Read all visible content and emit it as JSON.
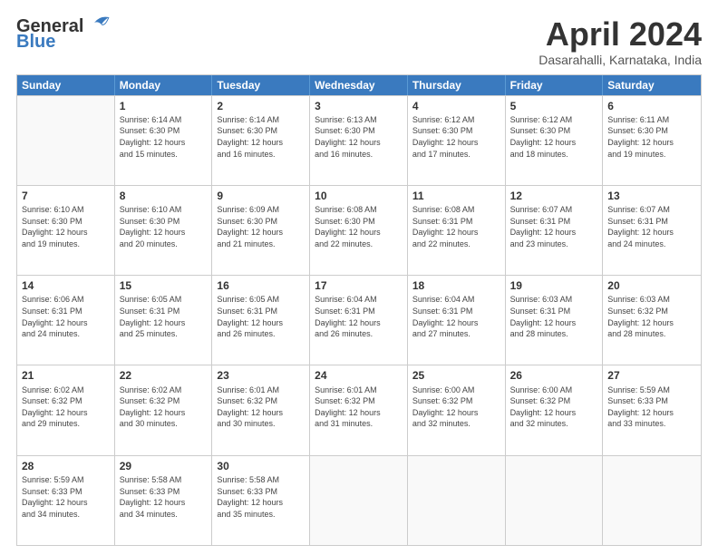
{
  "header": {
    "logo_line1": "General",
    "logo_line2": "Blue",
    "month_title": "April 2024",
    "location": "Dasarahalli, Karnataka, India"
  },
  "days_of_week": [
    "Sunday",
    "Monday",
    "Tuesday",
    "Wednesday",
    "Thursday",
    "Friday",
    "Saturday"
  ],
  "weeks": [
    [
      {
        "day": "",
        "info": ""
      },
      {
        "day": "1",
        "info": "Sunrise: 6:14 AM\nSunset: 6:30 PM\nDaylight: 12 hours\nand 15 minutes."
      },
      {
        "day": "2",
        "info": "Sunrise: 6:14 AM\nSunset: 6:30 PM\nDaylight: 12 hours\nand 16 minutes."
      },
      {
        "day": "3",
        "info": "Sunrise: 6:13 AM\nSunset: 6:30 PM\nDaylight: 12 hours\nand 16 minutes."
      },
      {
        "day": "4",
        "info": "Sunrise: 6:12 AM\nSunset: 6:30 PM\nDaylight: 12 hours\nand 17 minutes."
      },
      {
        "day": "5",
        "info": "Sunrise: 6:12 AM\nSunset: 6:30 PM\nDaylight: 12 hours\nand 18 minutes."
      },
      {
        "day": "6",
        "info": "Sunrise: 6:11 AM\nSunset: 6:30 PM\nDaylight: 12 hours\nand 19 minutes."
      }
    ],
    [
      {
        "day": "7",
        "info": "Sunrise: 6:10 AM\nSunset: 6:30 PM\nDaylight: 12 hours\nand 19 minutes."
      },
      {
        "day": "8",
        "info": "Sunrise: 6:10 AM\nSunset: 6:30 PM\nDaylight: 12 hours\nand 20 minutes."
      },
      {
        "day": "9",
        "info": "Sunrise: 6:09 AM\nSunset: 6:30 PM\nDaylight: 12 hours\nand 21 minutes."
      },
      {
        "day": "10",
        "info": "Sunrise: 6:08 AM\nSunset: 6:30 PM\nDaylight: 12 hours\nand 22 minutes."
      },
      {
        "day": "11",
        "info": "Sunrise: 6:08 AM\nSunset: 6:31 PM\nDaylight: 12 hours\nand 22 minutes."
      },
      {
        "day": "12",
        "info": "Sunrise: 6:07 AM\nSunset: 6:31 PM\nDaylight: 12 hours\nand 23 minutes."
      },
      {
        "day": "13",
        "info": "Sunrise: 6:07 AM\nSunset: 6:31 PM\nDaylight: 12 hours\nand 24 minutes."
      }
    ],
    [
      {
        "day": "14",
        "info": "Sunrise: 6:06 AM\nSunset: 6:31 PM\nDaylight: 12 hours\nand 24 minutes."
      },
      {
        "day": "15",
        "info": "Sunrise: 6:05 AM\nSunset: 6:31 PM\nDaylight: 12 hours\nand 25 minutes."
      },
      {
        "day": "16",
        "info": "Sunrise: 6:05 AM\nSunset: 6:31 PM\nDaylight: 12 hours\nand 26 minutes."
      },
      {
        "day": "17",
        "info": "Sunrise: 6:04 AM\nSunset: 6:31 PM\nDaylight: 12 hours\nand 26 minutes."
      },
      {
        "day": "18",
        "info": "Sunrise: 6:04 AM\nSunset: 6:31 PM\nDaylight: 12 hours\nand 27 minutes."
      },
      {
        "day": "19",
        "info": "Sunrise: 6:03 AM\nSunset: 6:31 PM\nDaylight: 12 hours\nand 28 minutes."
      },
      {
        "day": "20",
        "info": "Sunrise: 6:03 AM\nSunset: 6:32 PM\nDaylight: 12 hours\nand 28 minutes."
      }
    ],
    [
      {
        "day": "21",
        "info": "Sunrise: 6:02 AM\nSunset: 6:32 PM\nDaylight: 12 hours\nand 29 minutes."
      },
      {
        "day": "22",
        "info": "Sunrise: 6:02 AM\nSunset: 6:32 PM\nDaylight: 12 hours\nand 30 minutes."
      },
      {
        "day": "23",
        "info": "Sunrise: 6:01 AM\nSunset: 6:32 PM\nDaylight: 12 hours\nand 30 minutes."
      },
      {
        "day": "24",
        "info": "Sunrise: 6:01 AM\nSunset: 6:32 PM\nDaylight: 12 hours\nand 31 minutes."
      },
      {
        "day": "25",
        "info": "Sunrise: 6:00 AM\nSunset: 6:32 PM\nDaylight: 12 hours\nand 32 minutes."
      },
      {
        "day": "26",
        "info": "Sunrise: 6:00 AM\nSunset: 6:32 PM\nDaylight: 12 hours\nand 32 minutes."
      },
      {
        "day": "27",
        "info": "Sunrise: 5:59 AM\nSunset: 6:33 PM\nDaylight: 12 hours\nand 33 minutes."
      }
    ],
    [
      {
        "day": "28",
        "info": "Sunrise: 5:59 AM\nSunset: 6:33 PM\nDaylight: 12 hours\nand 34 minutes."
      },
      {
        "day": "29",
        "info": "Sunrise: 5:58 AM\nSunset: 6:33 PM\nDaylight: 12 hours\nand 34 minutes."
      },
      {
        "day": "30",
        "info": "Sunrise: 5:58 AM\nSunset: 6:33 PM\nDaylight: 12 hours\nand 35 minutes."
      },
      {
        "day": "",
        "info": ""
      },
      {
        "day": "",
        "info": ""
      },
      {
        "day": "",
        "info": ""
      },
      {
        "day": "",
        "info": ""
      }
    ]
  ]
}
